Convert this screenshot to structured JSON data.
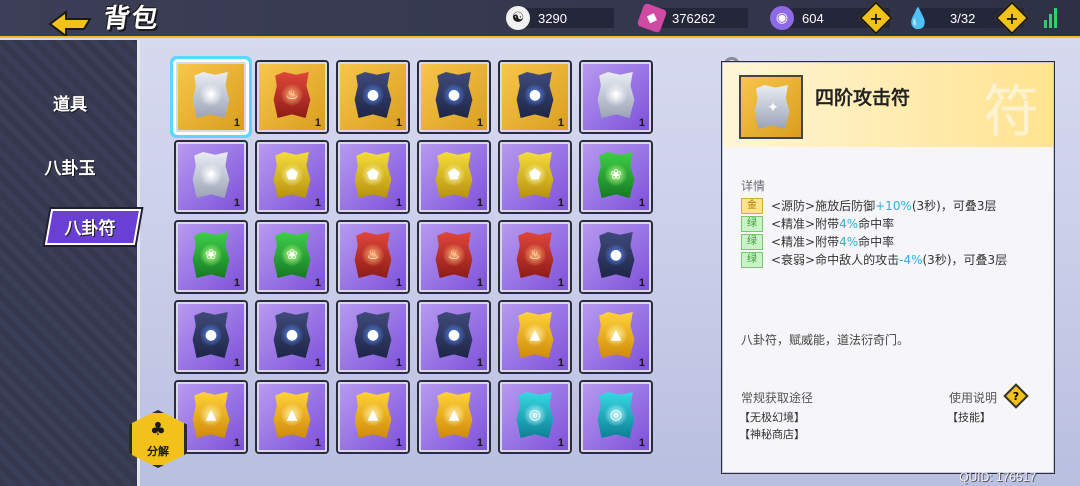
{
  "header": {
    "title": "背包",
    "resources": [
      {
        "icon": "yin-yang-icon",
        "value": "3290"
      },
      {
        "icon": "pink-crystal-icon",
        "value": "376262"
      },
      {
        "icon": "purple-orb-icon",
        "value": "604"
      },
      {
        "icon": "water-drop-icon",
        "value": "3/32"
      }
    ]
  },
  "sidebar": {
    "items": [
      {
        "label": "道具"
      },
      {
        "label": "八卦玉"
      },
      {
        "label": "八卦符",
        "active": true
      }
    ],
    "decompose_label": "分解"
  },
  "inventory": {
    "items": [
      {
        "frame": "gold",
        "element": "wind",
        "count": "1",
        "selected": true
      },
      {
        "frame": "gold",
        "element": "fire",
        "count": "1"
      },
      {
        "frame": "gold",
        "element": "water",
        "count": "1"
      },
      {
        "frame": "gold",
        "element": "water",
        "count": "1"
      },
      {
        "frame": "gold",
        "element": "water",
        "count": "1"
      },
      {
        "frame": "purple",
        "element": "wind",
        "count": "1"
      },
      {
        "frame": "purple",
        "element": "wind",
        "count": "1"
      },
      {
        "frame": "purple",
        "element": "shield",
        "count": "1"
      },
      {
        "frame": "purple",
        "element": "shield",
        "count": "1"
      },
      {
        "frame": "purple",
        "element": "shield",
        "count": "1"
      },
      {
        "frame": "purple",
        "element": "shield",
        "count": "1"
      },
      {
        "frame": "purple",
        "element": "wood",
        "count": "1"
      },
      {
        "frame": "purple",
        "element": "wood",
        "count": "1"
      },
      {
        "frame": "purple",
        "element": "wood",
        "count": "1"
      },
      {
        "frame": "purple",
        "element": "fire",
        "count": "1"
      },
      {
        "frame": "purple",
        "element": "fire",
        "count": "1"
      },
      {
        "frame": "purple",
        "element": "fire",
        "count": "1"
      },
      {
        "frame": "purple",
        "element": "water",
        "count": "1"
      },
      {
        "frame": "purple",
        "element": "water",
        "count": "1"
      },
      {
        "frame": "purple",
        "element": "water",
        "count": "1"
      },
      {
        "frame": "purple",
        "element": "water",
        "count": "1"
      },
      {
        "frame": "purple",
        "element": "water",
        "count": "1"
      },
      {
        "frame": "purple",
        "element": "mountain",
        "count": "1"
      },
      {
        "frame": "purple",
        "element": "mountain",
        "count": "1"
      },
      {
        "frame": "purple",
        "element": "mountain",
        "count": "1"
      },
      {
        "frame": "purple",
        "element": "mountain",
        "count": "1"
      },
      {
        "frame": "purple",
        "element": "mountain",
        "count": "1"
      },
      {
        "frame": "purple",
        "element": "mountain",
        "count": "1"
      },
      {
        "frame": "purple",
        "element": "wave",
        "count": "1"
      },
      {
        "frame": "purple",
        "element": "wave",
        "count": "1"
      }
    ]
  },
  "detail": {
    "watermark": "符",
    "name": "四阶攻击符",
    "section_label": "详情",
    "attributes": [
      {
        "tag": "金",
        "tier": "gold",
        "pre": "<源防>施放后防御",
        "hi": "+10%",
        "post": "(3秒)，可叠3层"
      },
      {
        "tag": "绿",
        "tier": "green",
        "pre": "<精准>附带",
        "hi": "4%",
        "post": "命中率"
      },
      {
        "tag": "绿",
        "tier": "green",
        "pre": "<精准>附带",
        "hi": "4%",
        "post": "命中率"
      },
      {
        "tag": "绿",
        "tier": "green",
        "pre": "<衰弱>命中敌人的攻击",
        "hi": "-4%",
        "post": "(3秒)，可叠3层"
      }
    ],
    "description": "八卦符，赋威能，道法衍奇门。",
    "source_title": "常规获取途径",
    "sources": [
      "【无极幻境】",
      "【神秘商店】"
    ],
    "usage_title": "使用说明",
    "usage_value": "【技能】"
  },
  "footer": {
    "quid": "QUID: 176517"
  },
  "colors": {
    "accent": "#f2c21a",
    "selection": "#5ad8ff",
    "highlight": "#2ab0e0",
    "tab_active": "#6a3fd3"
  }
}
